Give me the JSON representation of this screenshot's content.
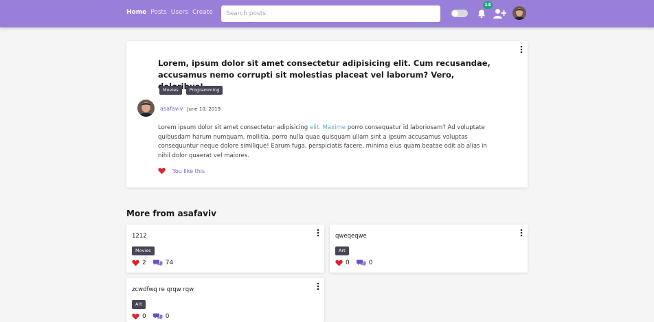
{
  "nav": {
    "home": "Home",
    "posts": "Posts",
    "users": "Users",
    "create": "Create"
  },
  "search": {
    "placeholder": "Search posts",
    "value": ""
  },
  "notifications": {
    "count": "14"
  },
  "icons": {
    "bell": "bell-icon",
    "add_user": "add-user-icon",
    "more": "more-vertical-icon",
    "heart": "heart-icon",
    "comments": "comments-icon"
  },
  "colors": {
    "header": "#9a7fd8",
    "accent": "#7b5fd0",
    "heart": "#e0202f",
    "badge": "#1aa37a",
    "tag": "#464655"
  },
  "post": {
    "title": "Lorem, ipsum dolor sit amet consectetur adipisicing elit. Cum recusandae, accusamus nemo corrupti sit molestias placeat vel laborum? Vero, doloribus!",
    "tags": [
      "Movies",
      "Programming"
    ],
    "author": "asafaviv",
    "date": "June 10, 2019",
    "body_start": "Lorem ipsum dolor sit amet consectetur adipisicing ",
    "body_link": "elit. Maxime",
    "body_rest": " porro consequatur id laboriosam? Ad voluptate quibusdam harum numquam, mollitia, porro nulla quae quisquam ullam sint a ipsum accusamus voluptas consequuntur neque dolore similique! Earum fuga, perspiciatis facere, minima eius quam beatae odit ab alias in nihil dolor quaerat vel maiores.",
    "like_text": "You like this"
  },
  "more": {
    "heading": "More from asafaviv",
    "posts": [
      {
        "title": "1212",
        "tag": "Movies",
        "likes": "2",
        "comments": "74"
      },
      {
        "title": "qweqeqwe",
        "tag": "Art",
        "likes": "0",
        "comments": "0"
      },
      {
        "title": "zcwdfwq re qrqw rqw",
        "tag": "Art",
        "likes": "0",
        "comments": "0"
      }
    ]
  }
}
